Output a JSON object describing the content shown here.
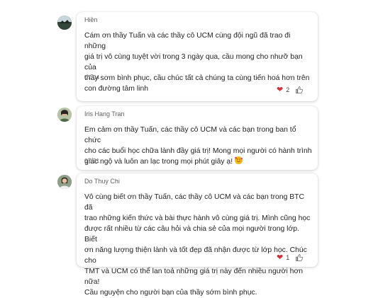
{
  "comments": [
    {
      "author": "Hiền",
      "lines": [
        "Cám ơn thầy Tuấn và các thầy cô UCM cùng đội ngũ đã trao đi những",
        "giá trị vô cùng tuyệt vời trong 3 ngày qua, cầu mong cho nhưỡ bạn của",
        "thầy sơm bình phục, cầu chúc tất cả chúng ta cùng tiến hoá hơn trên",
        "con đường tâm linh"
      ],
      "time": "07:04",
      "reaction_icon": "heart-icon",
      "reaction_count": "2"
    },
    {
      "author": "Iris Hang Tran",
      "lines": [
        "Em cảm ơn thầy Tuấn, các thầy cô UCM và các bạn trong ban tổ chức",
        "cho các buổi học chữa lành đầy giá trị! Mong mọi người có hành trình",
        "giác ngộ và luôn an lạc trong mọi phút giây ạ!"
      ],
      "emoji": "smiling-face-with-hearts-emoji",
      "time": "07:31"
    },
    {
      "author": "Do Thuy Chi",
      "lines": [
        "Vô cùng biết ơn thầy Tuấn, các thầy cô UCM và các bạn trong BTC đã",
        "trao những kiến thức và bài thực hành vô cùng giá trị. Mình cũng học",
        "được rất nhiều từ các câu hỏi và chia sẻ của mọi người trong lớp. Biết",
        "ơn năng lượng thiện lành và tốt đẹp đã nhận được từ lớp học. Chúc cho",
        "TMT và UCM có thể lan toả những giá trị này đến nhiều người hơn nữa!",
        "Cầu nguyện cho người bạn của thầy sớm bình phục."
      ],
      "reaction_icon": "heart-icon",
      "reaction_count": "1"
    }
  ],
  "colors": {
    "heart": "#d13438",
    "text": "#242424",
    "meta": "#616161"
  }
}
